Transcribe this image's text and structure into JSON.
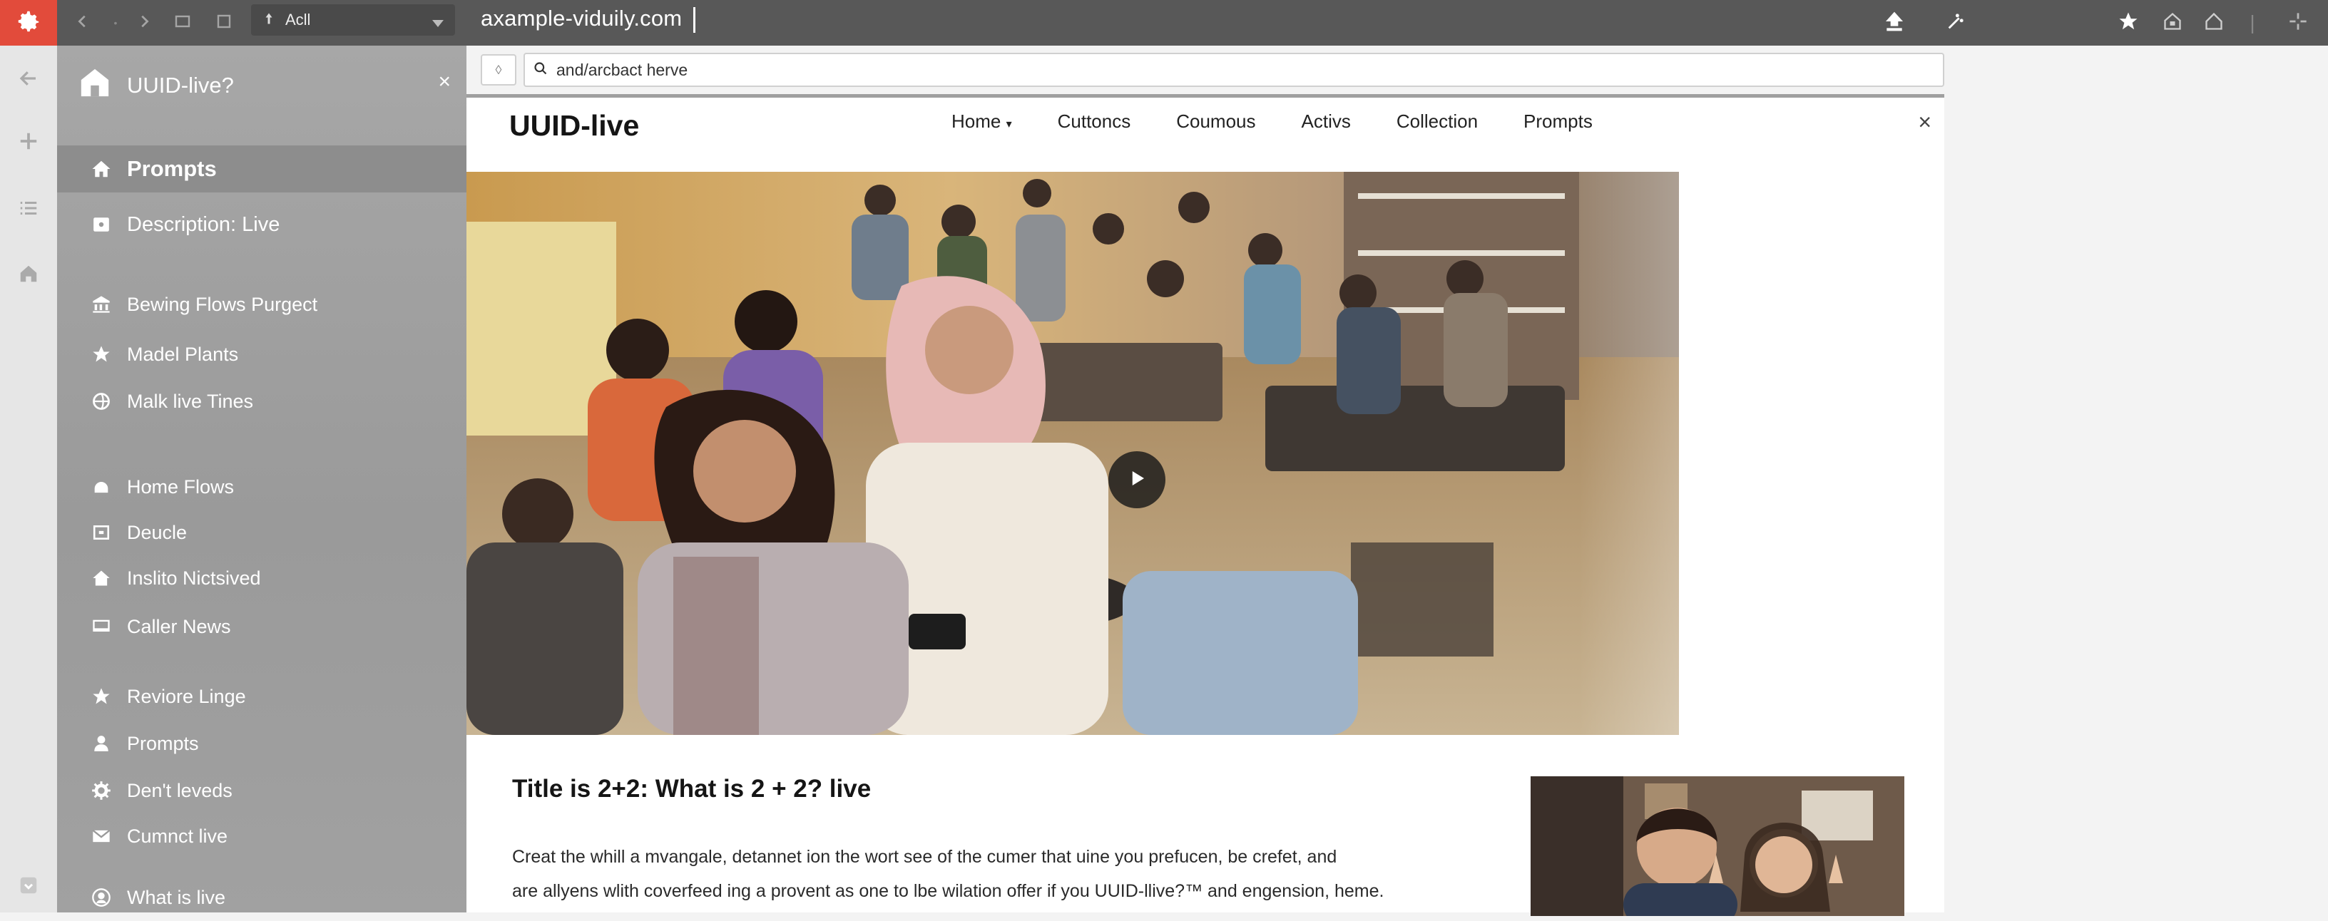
{
  "browser": {
    "url": "axample-viduily.com",
    "dropdown_label": "Acll",
    "icons": {
      "app": "gear-logo-icon",
      "back": "chevron-left-icon",
      "forward": "chevron-right-icon",
      "window": "window-icon",
      "tab": "tab-icon",
      "share": "upload-icon",
      "magic": "wand-icon",
      "bookmark": "star-icon",
      "home": "home-icon",
      "extension": "house-icon",
      "menu": "crosshair-icon"
    },
    "accent_color": "#e24b3b"
  },
  "address": {
    "query": "and/arcbact herve",
    "left_button": "◊"
  },
  "rail": {
    "icons": [
      "arrow-left-icon",
      "pin-icon",
      "list-icon",
      "home-icon",
      "download-icon"
    ]
  },
  "panel": {
    "title": "UUID-live?",
    "close": "×",
    "items": [
      {
        "label": "Prompts",
        "icon": "home-icon"
      },
      {
        "label": "Description: Live",
        "icon": "image-icon"
      },
      {
        "label": "Bewing Flows Purgect",
        "icon": "bank-icon"
      },
      {
        "label": "Madel Plants",
        "icon": "star-icon"
      },
      {
        "label": "Malk live Tines",
        "icon": "globe-icon"
      },
      {
        "label": "Home Flows",
        "icon": "cloud-icon"
      },
      {
        "label": "Deucle",
        "icon": "box-icon"
      },
      {
        "label": "Inslito Nictsived",
        "icon": "house-icon"
      },
      {
        "label": "Caller News",
        "icon": "monitor-icon"
      },
      {
        "label": "Reviore Linge",
        "icon": "star-icon"
      },
      {
        "label": "Prompts",
        "icon": "user-icon"
      },
      {
        "label": "Den't leveds",
        "icon": "gear-icon"
      },
      {
        "label": "Cumnct live",
        "icon": "mail-icon"
      },
      {
        "label": "What is live",
        "icon": "person-circle-icon"
      }
    ]
  },
  "site": {
    "title": "UUID-live",
    "nav": [
      "Home",
      "Cuttoncs",
      "Coumous",
      "Activs",
      "Collection",
      "Prompts"
    ],
    "close": "×"
  },
  "article": {
    "title": "Title is 2+2: What is 2 + 2? live",
    "paragraphs": [
      "Creat the whill a mvangale, detannet ion the wort see of the cumer that uine you prefucen, be crefet, and",
      "are allyens wlith coverfeed ing a provent as one to lbe wilation offer if you UUID-llive?™ and engension, heme."
    ]
  }
}
